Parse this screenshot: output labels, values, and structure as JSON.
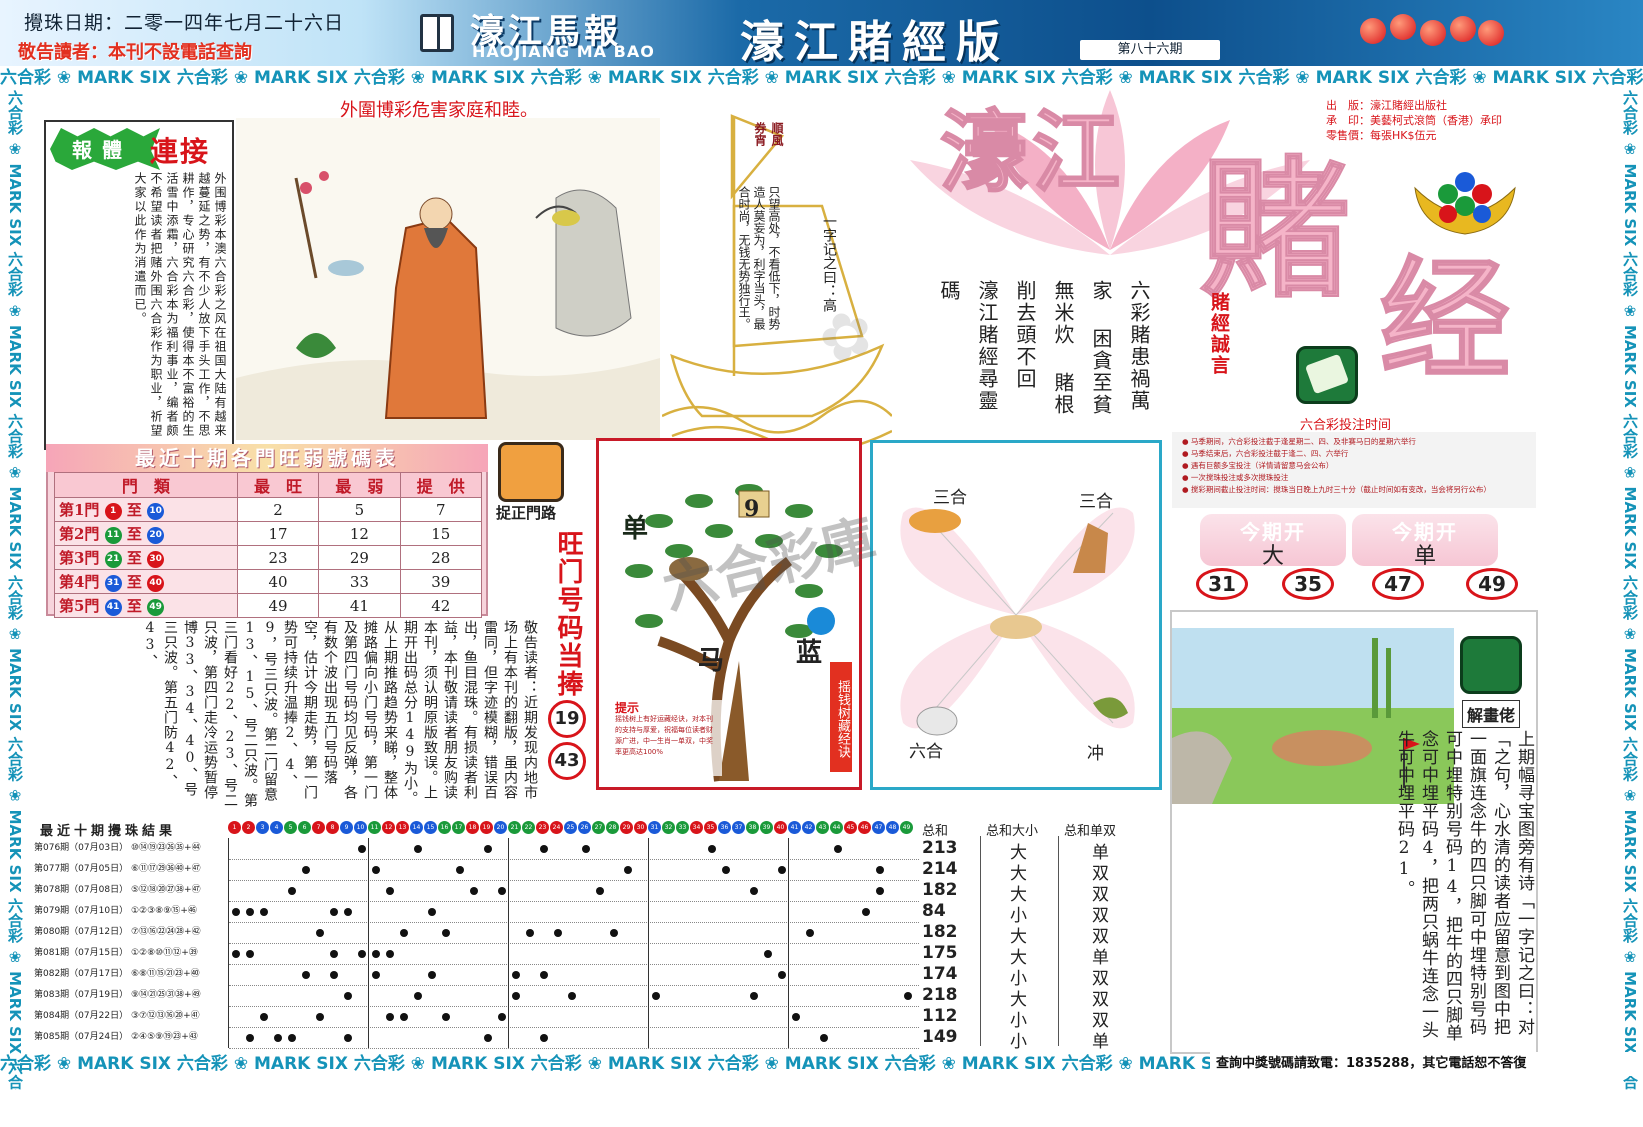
{
  "header": {
    "draw_date": "攪珠日期：二零一四年七月二十六日",
    "notice": "敬告讀者：本刊不設電話查詢",
    "paper_name": "濠江馬報",
    "paper_name_en": "HAOJIANG MA BAO",
    "edition_title": "濠江賭經版",
    "issue_no": "第八十六期"
  },
  "marquee_text": "六合彩 ❀ MARK SIX 六合彩 ❀ MARK SIX 六合彩 ❀ MARK SIX 六合彩 ❀ MARK SIX 六合彩 ❀ MARK SIX 六合彩 ❀ MARK SIX 六合彩 ❀ MARK SIX 六合彩 ❀ MARK SIX 六合彩 ❀ MARK SIX 六合彩 ❀ MARK SIX 六合彩 ❀ MARK SIX",
  "harm_notice": "外圍博彩危害家庭和睦。",
  "article": {
    "badge": "報體",
    "title": "連接",
    "body": "外围博彩本澳六合彩之风在祖国大陆有越来越蔓延之势，有不少人放下手头工作，不思耕作，专心研究六合彩，使得本不富裕的生活雪中添霜，六合彩本为福利事业，编者颇不希望读者把赌外围六合彩作为职业，祈望大家以此作为消遣而已。"
  },
  "boat": {
    "flag": "順風",
    "flag2": "券宵",
    "body": "只望高处，不看低下，时势造人莫妄为，利字当头，最合时尚，无钱无势独行王。",
    "sail": "一字记之曰：高"
  },
  "poem": [
    "六彩賭患禍萬家",
    "困貪至貧無米炊",
    "賭根削去頭不回",
    "濠江賭經尋靈碼"
  ],
  "motto_label": "賭經誠言",
  "title_art": [
    "濠江",
    "賭",
    "经"
  ],
  "pub_info": {
    "publisher": "出　版：濠江賭經出版社",
    "printer": "承　印：美藝柯式滾筒（香港）承印",
    "price": "零售價：每張HK$伍元"
  },
  "bet_time": {
    "label": "六合彩投注时间",
    "lines": [
      "● 马季期间，六合彩投注截于逢星期二、四、及非赛马日的星期六举行",
      "● 马季结束后，六合彩投注截于逢二、四、六举行",
      "● 遇有巨额多宝投注（详情请留意马会公布）",
      "● 一次搅珠投注或多次搅珠投注",
      "● 搅彩期间截止投注时间：搅珠当日晚上九时三十分（截止时间如有变改，当会将另行公布）"
    ]
  },
  "this_period": {
    "head": "今期开",
    "values": [
      "大",
      "单"
    ],
    "numbers": [
      "31",
      "35",
      "47",
      "49"
    ]
  },
  "door_table": {
    "title": "最近十期各門旺弱號碼表",
    "headers": [
      "門　類",
      "最　旺",
      "最　弱",
      "提　供"
    ],
    "rows": [
      {
        "door": "第1門",
        "from": "1",
        "to": "10",
        "c1": "red",
        "c2": "blue",
        "hot": "2",
        "cold": "5",
        "tip": "7"
      },
      {
        "door": "第2門",
        "from": "11",
        "to": "20",
        "c1": "green",
        "c2": "blue",
        "hot": "17",
        "cold": "12",
        "tip": "15"
      },
      {
        "door": "第3門",
        "from": "21",
        "to": "30",
        "c1": "green",
        "c2": "red",
        "hot": "23",
        "cold": "29",
        "tip": "28"
      },
      {
        "door": "第4門",
        "from": "31",
        "to": "40",
        "c1": "blue",
        "c2": "red",
        "hot": "40",
        "cold": "33",
        "tip": "39"
      },
      {
        "door": "第5門",
        "from": "41",
        "to": "49",
        "c1": "blue",
        "c2": "green",
        "hot": "49",
        "cold": "41",
        "tip": "42"
      }
    ],
    "range_word": "至"
  },
  "catch_label": "捉正門路",
  "vert_article": "敬告读者：近期发现内地市场上有本刊的翻版，虽内容雷同，但字迹模糊，错误百出，鱼目混珠。有损读者利益，本刊敬请读者朋友购读本刊，须认明原版致误。上期开出码总分149为小。从上期推路趋势来睇，整体摊路偏向小门号码，第一门及第四门号码均见反弹，各有数个波出现五门号码落空，估计今期走势，第一门势可持续升温捧2、4、9，号三只波。第二门留意13、15、号二只波。第三门看好22、23、号二只波，第四门走冷运势暂停博33、34、40、号三只波。第五门防42、43、",
  "hot_number": {
    "label": "旺门号码当捧",
    "numbers": [
      "19",
      "43"
    ]
  },
  "tree": {
    "single": "单",
    "number": "9",
    "horse": "马",
    "blue": "蓝",
    "side": "摇钱树藏经诀",
    "hint_title": "提示",
    "hint": "摇钱树上有好运藏经诀，对本刊的支持与厚爱，祝福每位读者财源广进，中一生肖一单双，中奖率更高达100%"
  },
  "zodiac": {
    "tl": "三合",
    "tr": "三合",
    "bl": "六合",
    "br": "冲"
  },
  "riddle": {
    "label": "解畫佬",
    "text": "上期幅寻宝图旁有诗「一字记之曰：对「之句，心水清的读者应留意到图中把一面旗连念牛的四只脚可中埋特别号码可中埋特别号码14，把牛的四只脚单念可中埋平码4，把两只蜗牛连念一头牛可中埋平码21。"
  },
  "results": {
    "title": "最近十期攪珠結果",
    "sum_headers": [
      "总和",
      "总和大小",
      "总和单双"
    ],
    "rows": [
      {
        "issue": "第076期（07月03日）",
        "balls": "⑩⑭⑲㉓㉖㉟",
        "special": "+㊹",
        "sum": "213",
        "bs": "大",
        "oe": "单"
      },
      {
        "issue": "第077期（07月05日）",
        "balls": "⑥⑪⑰㉙㊱㊵",
        "special": "+㊼",
        "sum": "214",
        "bs": "大",
        "oe": "双"
      },
      {
        "issue": "第078期（07月08日）",
        "balls": "⑤⑫⑱⑳㉗㊳",
        "special": "+㊼",
        "sum": "182",
        "bs": "大",
        "oe": "双"
      },
      {
        "issue": "第079期（07月10日）",
        "balls": "①②③⑧⑨⑮",
        "special": "+㊻",
        "sum": "84",
        "bs": "小",
        "oe": "双"
      },
      {
        "issue": "第080期（07月12日）",
        "balls": "⑦⑬⑯㉒㉔㉘",
        "special": "+㊷",
        "sum": "182",
        "bs": "大",
        "oe": "双"
      },
      {
        "issue": "第081期（07月15日）",
        "balls": "①②⑧⑩⑪⑫",
        "special": "+㊴",
        "sum": "175",
        "bs": "大",
        "oe": "单"
      },
      {
        "issue": "第082期（07月17日）",
        "balls": "⑥⑧⑪⑮㉑㉓",
        "special": "+㊵",
        "sum": "174",
        "bs": "小",
        "oe": "双"
      },
      {
        "issue": "第083期（07月19日）",
        "balls": "⑨⑭㉑㉕㉛㊳",
        "special": "+㊾",
        "sum": "218",
        "bs": "大",
        "oe": "双"
      },
      {
        "issue": "第084期（07月22日）",
        "balls": "③⑦⑫⑬⑯⑳",
        "special": "+㊶",
        "sum": "112",
        "bs": "小",
        "oe": "双"
      },
      {
        "issue": "第085期（07月24日）",
        "balls": "②④⑤⑨⑲㉓",
        "special": "+㊸",
        "sum": "149",
        "bs": "小",
        "oe": "单"
      }
    ]
  },
  "hotline": "查詢中獎號碼請致電：1835288，其它電話恕不答復"
}
